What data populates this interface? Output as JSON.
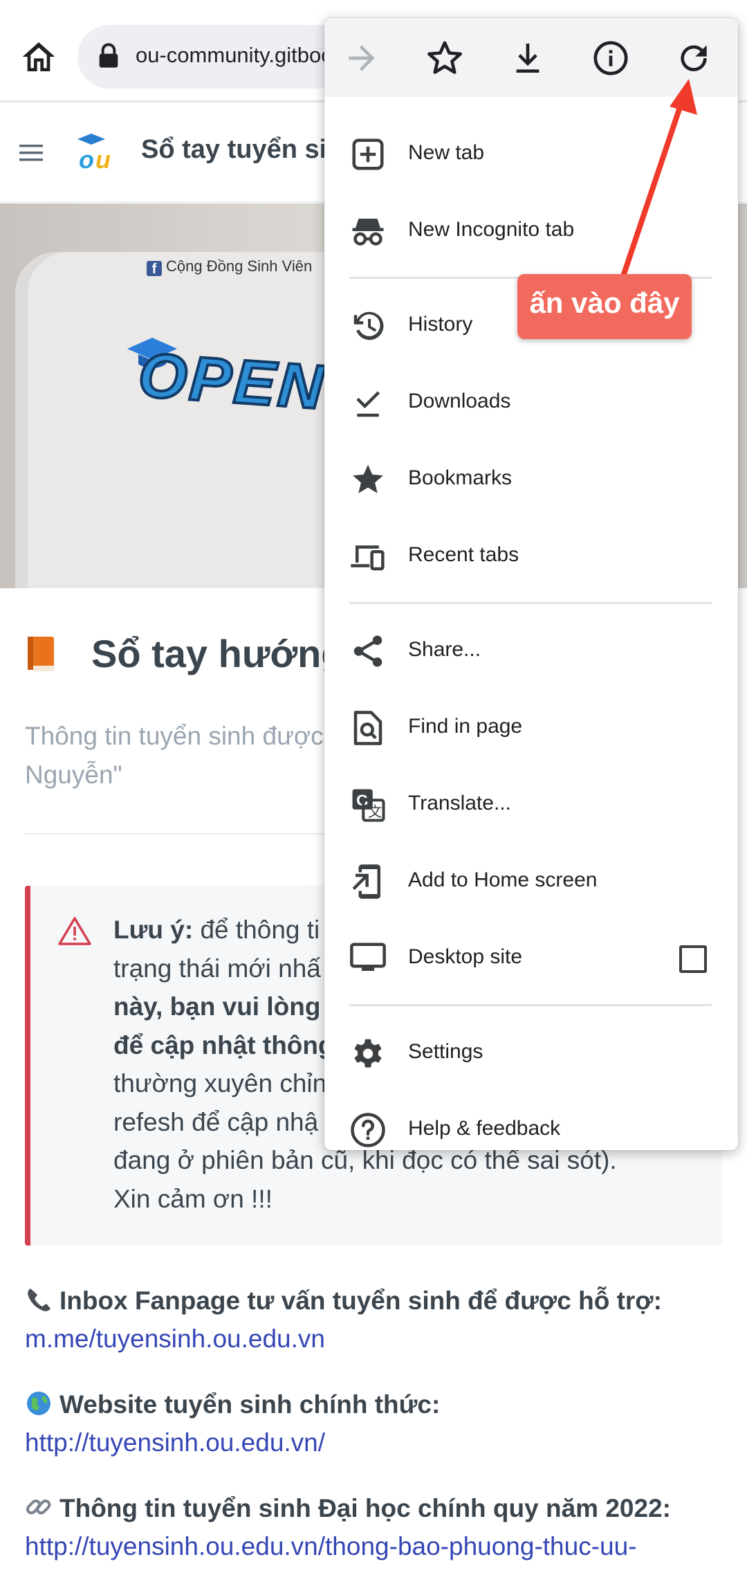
{
  "browser": {
    "url": "ou-community.gitbook.io"
  },
  "site": {
    "title": "Sổ tay tuyển sinh"
  },
  "cover": {
    "fb_text": "Cộng Đồng Sinh Viên",
    "logo_text": "OPEN U"
  },
  "page": {
    "title": "Sổ tay hướng",
    "subtitle": "Thông tin tuyển sinh được\nNguyễn\""
  },
  "alert": {
    "label": "Lưu ý:",
    "line1": " để thông ti",
    "line2": "trạng thái mới nhấ",
    "bold1": "này, bạn vui lòng",
    "bold2": "để cập nhật thông",
    "line3": "thường xuyên chỉn",
    "line4": "refesh để cập nhậ",
    "line5": "đang ở phiên bản cũ, khi đọc có thể sai sót).",
    "line6": "Xin cảm ơn !!!"
  },
  "info": [
    {
      "icon": "phone-icon",
      "heading": "Inbox Fanpage tư vấn tuyển sinh để được hỗ trợ:",
      "link": "m.me/tuyensinh.ou.edu.vn"
    },
    {
      "icon": "globe-icon",
      "heading": "Website tuyển sinh chính thức:",
      "link": "http://tuyensinh.ou.edu.vn/"
    },
    {
      "icon": "link-icon",
      "heading": "Thông tin tuyển sinh Đại học chính quy năm 2022:",
      "link": "http://tuyensinh.ou.edu.vn/thong-bao-phuong-thuc-uu-"
    }
  ],
  "menu": {
    "items": [
      {
        "label": "New tab",
        "icon": "new-tab-icon"
      },
      {
        "label": "New Incognito tab",
        "icon": "incognito-icon"
      },
      {
        "label": "History",
        "icon": "history-icon"
      },
      {
        "label": "Downloads",
        "icon": "downloads-icon"
      },
      {
        "label": "Bookmarks",
        "icon": "bookmarks-icon"
      },
      {
        "label": "Recent tabs",
        "icon": "recent-tabs-icon"
      },
      {
        "label": "Share...",
        "icon": "share-icon"
      },
      {
        "label": "Find in page",
        "icon": "find-in-page-icon"
      },
      {
        "label": "Translate...",
        "icon": "translate-icon"
      },
      {
        "label": "Add to Home screen",
        "icon": "add-to-home-icon"
      },
      {
        "label": "Desktop site",
        "icon": "desktop-icon"
      },
      {
        "label": "Settings",
        "icon": "settings-icon"
      },
      {
        "label": "Help & feedback",
        "icon": "help-icon"
      }
    ],
    "desktop_site_checked": false
  },
  "annotation": {
    "callout_text": "ấn vào đây",
    "color": "#f26a5e"
  }
}
